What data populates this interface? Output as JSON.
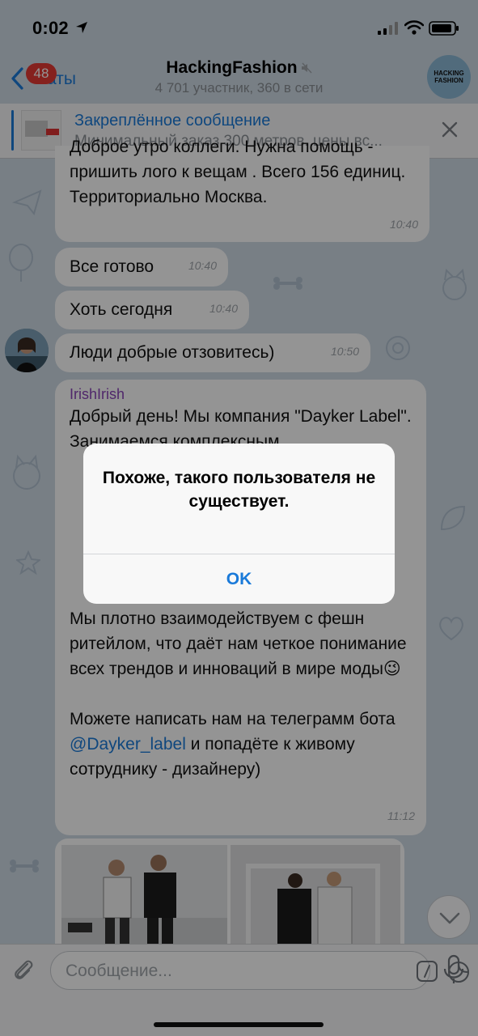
{
  "status_bar": {
    "time": "0:02"
  },
  "header": {
    "back_label": "Чаты",
    "unread_badge": "48",
    "title": "HackingFashion",
    "subtitle": "4 701 участник, 360 в сети",
    "channel_avatar_text": "HACKING FASHION"
  },
  "pinned": {
    "title": "Закреплённое сообщение",
    "preview": "Минимальный заказ 300 метров, цены вс..."
  },
  "messages": [
    {
      "text": "Доброе утро коллеги. Нужна помощь - пришить лого к вещам . Всего 156 единиц. Территориально Москва.",
      "time": "10:40"
    },
    {
      "text": "Все готово",
      "time": "10:40"
    },
    {
      "text": "Хоть сегодня",
      "time": "10:40"
    },
    {
      "text": "Люди добрые отзовитесь)",
      "time": "10:50"
    },
    {
      "sender": "IrishIrish",
      "text_part1": "Добрый день! Мы компания \"Dayker Label\". Занимаемся комплексным",
      "text_part2": "Мы плотно взаимодействуем с фешн ритейлом, что даёт нам четкое понимание всех трендов и инноваций в мире моды",
      "emoji": "😉",
      "text_part3": "Можете написать нам на телеграмм бота",
      "mention": "@Dayker_label",
      "text_part4": "и попадёте к живому сотруднику - дизайнеру)",
      "time": "11:12"
    }
  ],
  "input": {
    "placeholder": "Сообщение..."
  },
  "alert": {
    "message": "Похоже, такого пользователя не существует.",
    "ok_label": "OK"
  },
  "colors": {
    "accent": "#1a7ad9",
    "badge": "#e53935",
    "sender": "#8a44b8"
  }
}
